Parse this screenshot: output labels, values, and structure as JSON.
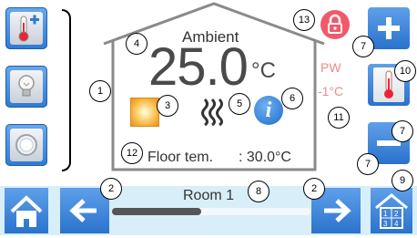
{
  "ambient": {
    "label": "Ambient",
    "temperature": "25.0",
    "unit": "°C"
  },
  "floor": {
    "label": "Floor tem.",
    "value": ": 30.0°C"
  },
  "pw": {
    "label": "PW",
    "offset": "-1°C"
  },
  "room": {
    "name": "Room 1",
    "progress": 0.45
  },
  "callouts": {
    "c1": "1",
    "c2a": "2",
    "c2b": "2",
    "c3": "3",
    "c4": "4",
    "c5": "5",
    "c6": "6",
    "c7a": "7",
    "c7b": "7",
    "c7c": "7",
    "c8": "8",
    "c9": "9",
    "c10": "10",
    "c11": "11",
    "c12": "12",
    "c13": "13"
  },
  "colors": {
    "accent": "#2f7ad3",
    "lock": "#f05a6a",
    "pw": "#f08a8a",
    "bottom_bar": "#d8eef8"
  },
  "icons": [
    "thermometer-plus-icon",
    "bulb-icon",
    "circle-button-icon",
    "home-icon",
    "arrow-left-icon",
    "arrow-right-icon",
    "plus-icon",
    "minus-icon",
    "thermometer-icon",
    "lock-icon",
    "info-icon",
    "heating-icon",
    "sun-icon",
    "room-grid-icon"
  ]
}
